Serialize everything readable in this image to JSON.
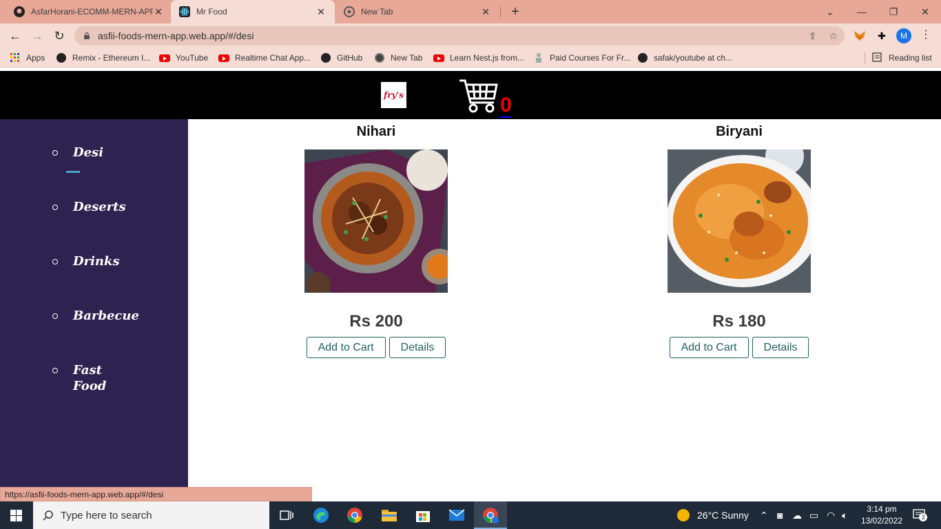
{
  "browser": {
    "tabs": [
      {
        "title": "AsfarHorani-ECOMM-MERN-APP",
        "icon": "github-icon"
      },
      {
        "title": "Mr Food",
        "icon": "react-icon",
        "active": true
      },
      {
        "title": "New Tab",
        "icon": "chrome-icon"
      }
    ],
    "url": "asfii-foods-mern-app.web.app/#/desi",
    "profile_initial": "M",
    "bookmarks": [
      {
        "label": "Apps",
        "icon": "apps-grid-icon"
      },
      {
        "label": "Remix - Ethereum I...",
        "icon": "remix-icon"
      },
      {
        "label": "YouTube",
        "icon": "youtube-icon"
      },
      {
        "label": "Realtime Chat App...",
        "icon": "youtube-icon"
      },
      {
        "label": "GitHub",
        "icon": "github-icon"
      },
      {
        "label": "New Tab",
        "icon": "globe-icon"
      },
      {
        "label": "Learn Nest.js from...",
        "icon": "youtube-icon"
      },
      {
        "label": "Paid Courses For Fr...",
        "icon": "course-icon"
      },
      {
        "label": "safak/youtube at ch...",
        "icon": "github-icon"
      }
    ],
    "reading_list": "Reading list",
    "status_url": "https://asfii-foods-mern-app.web.app/#/desi"
  },
  "site": {
    "logo_text": "fry's",
    "cart_count": "0",
    "categories": [
      "Desi",
      "Deserts",
      "Drinks",
      "Barbecue",
      "Fast Food"
    ],
    "active_category": "Desi",
    "products": [
      {
        "name": "Nihari",
        "price": "Rs 200",
        "add_label": "Add to Cart",
        "details_label": "Details"
      },
      {
        "name": "Biryani",
        "price": "Rs 180",
        "add_label": "Add to Cart",
        "details_label": "Details"
      }
    ]
  },
  "taskbar": {
    "search_placeholder": "Type here to search",
    "weather": "26°C  Sunny",
    "time": "3:14 pm",
    "date": "13/02/2022",
    "notification_count": "3"
  },
  "colors": {
    "tabstrip": "#e8a898",
    "toolbar": "#f5dcd4",
    "sidebar": "#2e2350",
    "header": "#000000",
    "cart_count": "#ee0000",
    "button_border": "#1f5f5f"
  }
}
